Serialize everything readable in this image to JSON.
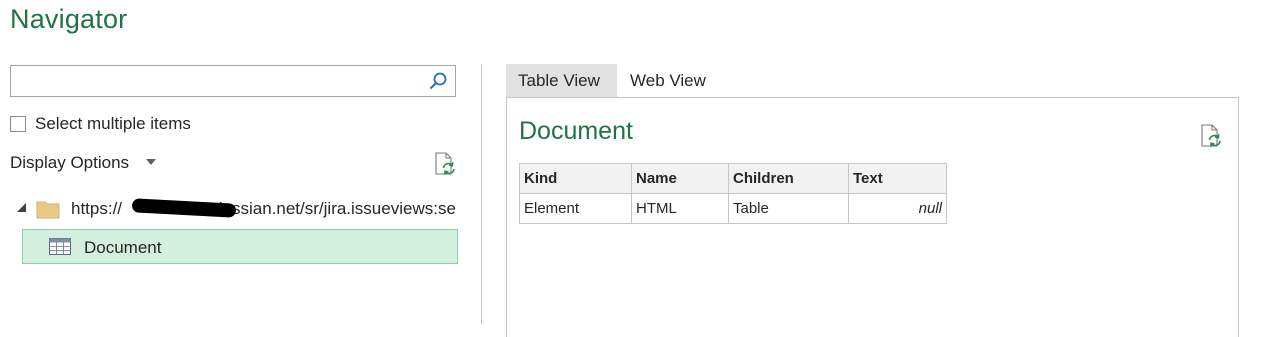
{
  "title": "Navigator",
  "search": {
    "placeholder": "",
    "value": ""
  },
  "select_multiple": {
    "label": "Select multiple items",
    "checked": false
  },
  "display_options": {
    "label": "Display Options"
  },
  "tree": {
    "root": {
      "label": "https://[redacted].atlassian.net/sr/jira.issueviews:se...",
      "visible_text_start": "https://",
      "visible_text_end": "tlassian.net/sr/jira.issueviews:se..."
    },
    "child": {
      "label": "Document",
      "selected": true
    }
  },
  "tabs": [
    {
      "label": "Table View",
      "active": true
    },
    {
      "label": "Web View",
      "active": false
    }
  ],
  "preview": {
    "title": "Document",
    "columns": [
      "Kind",
      "Name",
      "Children",
      "Text"
    ],
    "rows": [
      [
        "Element",
        "HTML",
        "Table",
        "null"
      ]
    ]
  },
  "colors": {
    "accent": "#217346",
    "selected_bg": "#d3efdf",
    "tab_active_bg": "#e1e1e1"
  }
}
